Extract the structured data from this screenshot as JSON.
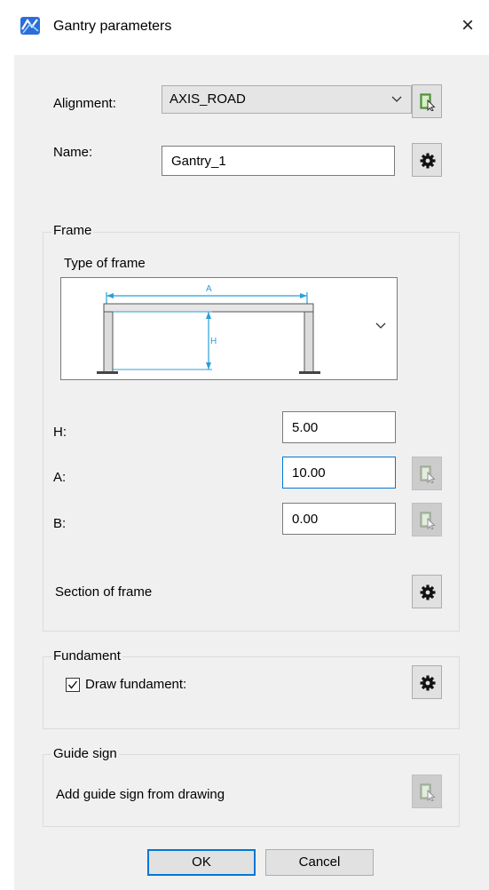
{
  "window": {
    "title": "Gantry parameters",
    "close_glyph": "×",
    "icon": "gantry-app-icon"
  },
  "alignment": {
    "label": "Alignment:",
    "value": "AXIS_ROAD",
    "pick_icon": "pick-from-drawing-icon"
  },
  "name": {
    "label": "Name:",
    "value": "Gantry_1",
    "settings_icon": "gear-icon"
  },
  "frame": {
    "group_title": "Frame",
    "type_label": "Type of frame",
    "diagram_labels": {
      "a": "A",
      "h": "H"
    },
    "fields": [
      {
        "label": "H:",
        "value": "5.00"
      },
      {
        "label": "A:",
        "value": "10.00"
      },
      {
        "label": "B:",
        "value": "0.00"
      }
    ],
    "section_label": "Section of frame"
  },
  "fundament": {
    "group_title": "Fundament",
    "checkbox_label": "Draw fundament:",
    "checked": true
  },
  "guide_sign": {
    "group_title": "Guide sign",
    "label": "Add guide sign from drawing"
  },
  "buttons": {
    "ok": "OK",
    "cancel": "Cancel"
  },
  "colors": {
    "accent": "#0078d7",
    "dialog_bg": "#f0f0f0",
    "diagram_line": "#29a0d8"
  }
}
